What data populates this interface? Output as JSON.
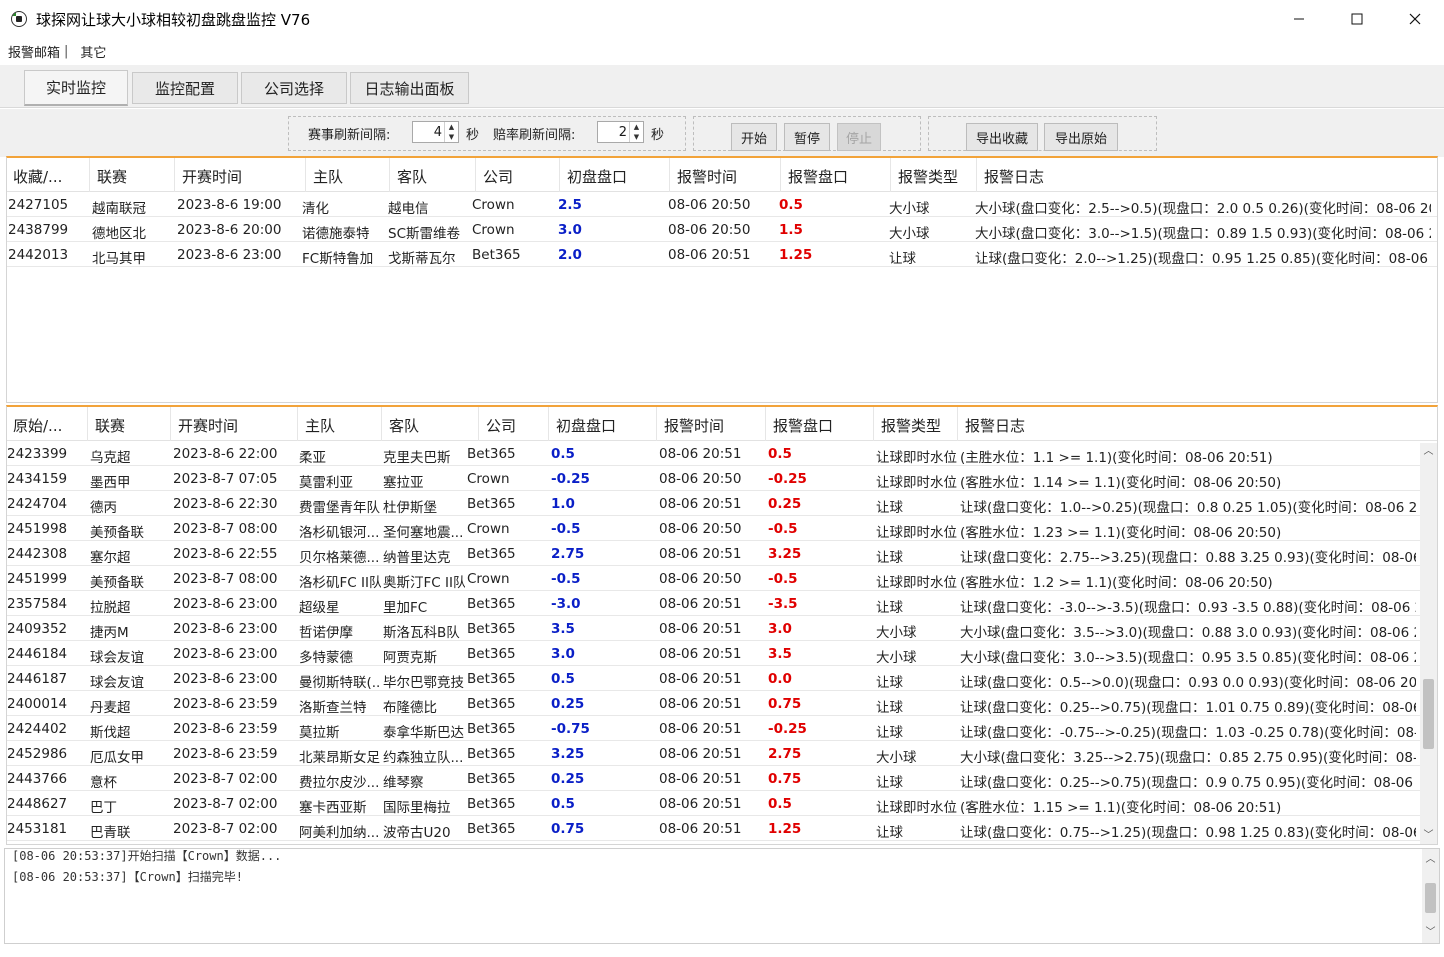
{
  "window": {
    "title": "球探网让球大小球相较初盘跳盘监控 V76",
    "minimize_glyph": "—",
    "maximize_glyph": "☐",
    "close_glyph": "✕"
  },
  "menu": {
    "alarm_email": "报警邮箱",
    "separator": "|",
    "other": "其它"
  },
  "tabs": [
    "实时监控",
    "监控配置",
    "公司选择",
    "日志输出面板"
  ],
  "controls": {
    "match_refresh_label": "赛事刷新间隔:",
    "match_refresh_value": "4",
    "match_refresh_unit": "秒",
    "odds_refresh_label": "赔率刷新间隔:",
    "odds_refresh_value": "2",
    "odds_refresh_unit": "秒",
    "start": "开始",
    "pause": "暂停",
    "stop": "停止",
    "export_fav": "导出收藏",
    "export_raw": "导出原始"
  },
  "fav_table": {
    "headers": [
      "收藏/...",
      "联赛",
      "开赛时间",
      "主队",
      "客队",
      "公司",
      "初盘盘口",
      "报警时间",
      "报警盘口",
      "报警类型",
      "报警日志"
    ],
    "rows": [
      [
        "2427105",
        "越南联冠",
        "2023-8-6 19:00",
        "清化",
        "越电信",
        "Crown",
        "2.5",
        "08-06 20:50",
        "0.5",
        "大小球",
        "大小球(盘口变化：2.5-->0.5)(现盘口：2.0  0.5  0.26)(变化时间：08-06 20:..."
      ],
      [
        "2438799",
        "德地区北",
        "2023-8-6 20:00",
        "诺德施泰特",
        "SC斯雷维卷",
        "Crown",
        "3.0",
        "08-06 20:50",
        "1.5",
        "大小球",
        "大小球(盘口变化：3.0-->1.5)(现盘口：0.89  1.5  0.93)(变化时间：08-06 20..."
      ],
      [
        "2442013",
        "北马其甲",
        "2023-8-6 23:00",
        "FC斯特鲁加",
        "戈斯蒂瓦尔",
        "Bet365",
        "2.0",
        "08-06 20:51",
        "1.25",
        "让球",
        "让球(盘口变化：2.0-->1.25)(现盘口：0.95  1.25  0.85)(变化时间：08-06 2..."
      ]
    ]
  },
  "raw_table": {
    "headers": [
      "原始/...",
      "联赛",
      "开赛时间",
      "主队",
      "客队",
      "公司",
      "初盘盘口",
      "报警时间",
      "报警盘口",
      "报警类型",
      "报警日志"
    ],
    "rows": [
      [
        "2423399",
        "乌克超",
        "2023-8-6 22:00",
        "柔亚",
        "克里夫巴斯",
        "Bet365",
        "0.5",
        "08-06 20:51",
        "0.5",
        "让球即时水位",
        "(主胜水位：1.1 >= 1.1)(变化时间：08-06 20:51)"
      ],
      [
        "2434159",
        "墨西甲",
        "2023-8-7 07:05",
        "莫雷利亚",
        "塞拉亚",
        "Crown",
        "-0.25",
        "08-06 20:50",
        "-0.25",
        "让球即时水位",
        "(客胜水位：1.14 >= 1.1)(变化时间：08-06 20:50)"
      ],
      [
        "2424704",
        "德丙",
        "2023-8-6 22:30",
        "费雷堡青年队",
        "杜伊斯堡",
        "Bet365",
        "1.0",
        "08-06 20:51",
        "0.25",
        "让球",
        "让球(盘口变化：1.0-->0.25)(现盘口：0.8  0.25  1.05)(变化时间：08-06 20:..."
      ],
      [
        "2451998",
        "美预备联",
        "2023-8-7 08:00",
        "洛杉矶银河...",
        "圣何塞地震...",
        "Crown",
        "-0.5",
        "08-06 20:50",
        "-0.5",
        "让球即时水位",
        "(客胜水位：1.23 >= 1.1)(变化时间：08-06 20:50)"
      ],
      [
        "2442308",
        "塞尔超",
        "2023-8-6 22:55",
        "贝尔格莱德...",
        "纳普里达克",
        "Bet365",
        "2.75",
        "08-06 20:51",
        "3.25",
        "让球",
        "让球(盘口变化：2.75-->3.25)(现盘口：0.88  3.25  0.93)(变化时间：08-06 ..."
      ],
      [
        "2451999",
        "美预备联",
        "2023-8-7 08:00",
        "洛杉矶FC II队",
        "奥斯汀FC II队",
        "Crown",
        "-0.5",
        "08-06 20:50",
        "-0.5",
        "让球即时水位",
        "(客胜水位：1.2 >= 1.1)(变化时间：08-06 20:50)"
      ],
      [
        "2357584",
        "拉脱超",
        "2023-8-6 23:00",
        "超级星",
        "里加FC",
        "Bet365",
        "-3.0",
        "08-06 20:51",
        "-3.5",
        "让球",
        "让球(盘口变化：-3.0-->-3.5)(现盘口：0.93  -3.5  0.88)(变化时间：08-06 2..."
      ],
      [
        "2409352",
        "捷丙M",
        "2023-8-6 23:00",
        "哲诺伊摩",
        "斯洛瓦科B队",
        "Bet365",
        "3.5",
        "08-06 20:51",
        "3.0",
        "大小球",
        "大小球(盘口变化：3.5-->3.0)(现盘口：0.88  3.0  0.93)(变化时间：08-06 2..."
      ],
      [
        "2446184",
        "球会友谊",
        "2023-8-6 23:00",
        "多特蒙德",
        "阿贾克斯",
        "Bet365",
        "3.0",
        "08-06 20:51",
        "3.5",
        "大小球",
        "大小球(盘口变化：3.0-->3.5)(现盘口：0.95  3.5  0.85)(变化时间：08-06 2..."
      ],
      [
        "2446187",
        "球会友谊",
        "2023-8-6 23:00",
        "曼彻斯特联(...",
        "毕尔巴鄂竞技",
        "Bet365",
        "0.5",
        "08-06 20:51",
        "0.0",
        "让球",
        "让球(盘口变化：0.5-->0.0)(现盘口：0.93  0.0  0.93)(变化时间：08-06 20:5..."
      ],
      [
        "2400014",
        "丹麦超",
        "2023-8-6 23:59",
        "洛斯查兰特",
        "布隆德比",
        "Bet365",
        "0.25",
        "08-06 20:51",
        "0.75",
        "让球",
        "让球(盘口变化：0.25-->0.75)(现盘口：1.01  0.75  0.89)(变化时间：08-06 ..."
      ],
      [
        "2424402",
        "斯伐超",
        "2023-8-6 23:59",
        "莫拉斯",
        "泰拿华斯巴达",
        "Bet365",
        "-0.75",
        "08-06 20:51",
        "-0.25",
        "让球",
        "让球(盘口变化：-0.75-->-0.25)(现盘口：1.03  -0.25  0.78)(变化时间：08-..."
      ],
      [
        "2452986",
        "厄瓜女甲",
        "2023-8-6 23:59",
        "北莱昂斯女足",
        "约森独立队...",
        "Bet365",
        "3.25",
        "08-06 20:51",
        "2.75",
        "大小球",
        "大小球(盘口变化：3.25-->2.75)(现盘口：0.85  2.75  0.95)(变化时间：08-0..."
      ],
      [
        "2443766",
        "意杯",
        "2023-8-7 02:00",
        "费拉尔皮沙...",
        "维琴察",
        "Bet365",
        "0.25",
        "08-06 20:51",
        "0.75",
        "让球",
        "让球(盘口变化：0.25-->0.75)(现盘口：0.9  0.75  0.95)(变化时间：08-06 2..."
      ],
      [
        "2448627",
        "巴丁",
        "2023-8-7 02:00",
        "塞卡西亚斯",
        "国际里梅拉",
        "Bet365",
        "0.5",
        "08-06 20:51",
        "0.5",
        "让球即时水位",
        "(客胜水位：1.15 >= 1.1)(变化时间：08-06 20:51)"
      ],
      [
        "2453181",
        "巴青联",
        "2023-8-7 02:00",
        "阿美利加纳...",
        "波帝古U20",
        "Bet365",
        "0.75",
        "08-06 20:51",
        "1.25",
        "让球",
        "让球(盘口变化：0.75-->1.25)(现盘口：0.98  1.25  0.83)(变化时间：08-06 ..."
      ]
    ]
  },
  "log": {
    "lines": [
      "[08-06 20:53:37]开始扫描【Crown】数据...",
      "[08-06 20:53:37]【Crown】扫描完毕!"
    ]
  }
}
